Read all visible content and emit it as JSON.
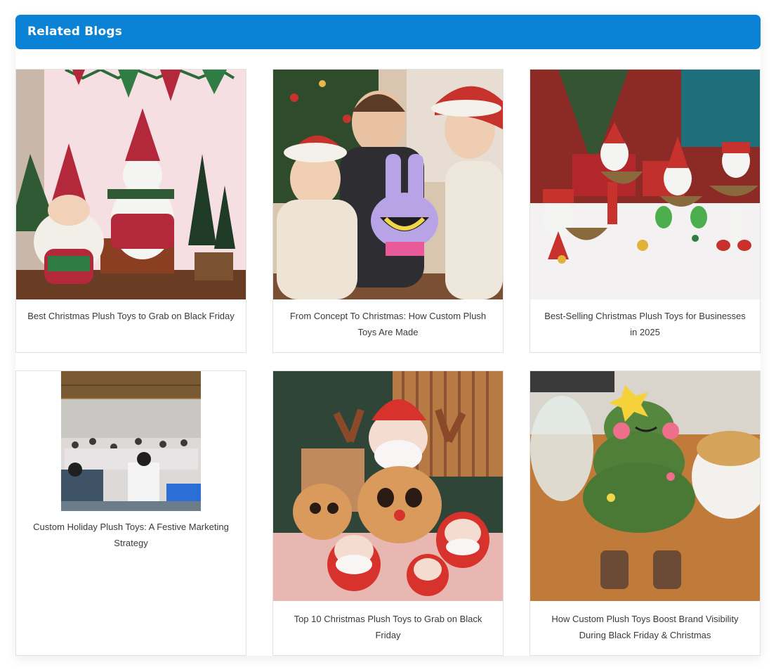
{
  "section": {
    "title": "Related Blogs"
  },
  "colors": {
    "header_bg": "#0a82d6",
    "header_text": "#ffffff",
    "caption_text": "#3a3a3a"
  },
  "blogs": [
    {
      "title": "Best Christmas Plush Toys to Grab on Black Friday"
    },
    {
      "title": "From Concept To Christmas: How Custom Plush Toys Are Made"
    },
    {
      "title": "Best-Selling Christmas Plush Toys for Businesses in 2025"
    },
    {
      "title": "Custom Holiday Plush Toys: A Festive Marketing Strategy"
    },
    {
      "title": "Top 10 Christmas Plush Toys to Grab on Black Friday"
    },
    {
      "title": "How Custom Plush Toys Boost Brand Visibility During Black Friday & Christmas"
    }
  ]
}
